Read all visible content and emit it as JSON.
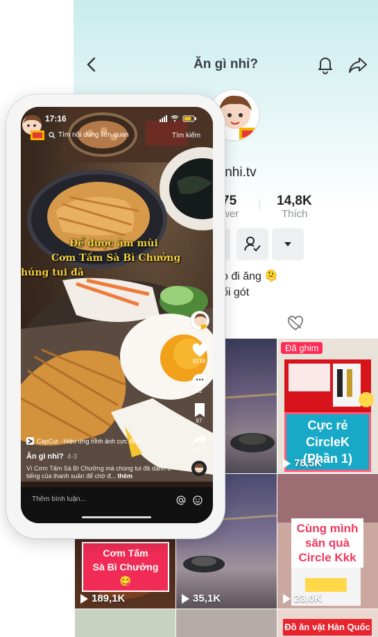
{
  "profile": {
    "title": "Ăn gì nhỉ?",
    "username_partial": "inhi.tv",
    "stats": [
      {
        "value": "75",
        "label": "wer"
      },
      {
        "value": "14,8K",
        "label": "Thích"
      }
    ],
    "bio_line1": "o đi ăng 🫠",
    "bio_line2": "ối gót",
    "grid": [
      {
        "views": "",
        "pinned": ""
      },
      {
        "views": "78,5K",
        "pinned": "Đã ghim",
        "caption": "Cực rẻ CircleK\n(Phần 1)"
      },
      {
        "views": "189,1K",
        "caption": "Cơm Tấm\nSà Bì Chưởng 😋"
      },
      {
        "views": "35,1K"
      },
      {
        "views": "23,0K",
        "caption": "Cùng mình\nsăn quà\nCircle Kkk"
      },
      {
        "caption": "Đồ ăn vặt Hàn Quốc"
      }
    ]
  },
  "phone": {
    "time": "17:16",
    "search_placeholder": "Tìm nội dung liên quan",
    "search_button": "Tìm kiếm",
    "overlay_line1": "Để được ăm mùi",
    "overlay_line2": "Cơm Tấm Sà Bì Chưởng",
    "overlay_line3": "húng tui đã",
    "likes": "8218",
    "comments": "82",
    "saves": "87",
    "shares": "154",
    "capcut": "CapCut · Hiệu ứng hình ảnh cực đỉnh",
    "author": "Ăn gì nhỉ?",
    "date": "4-3",
    "description": "Vì Cơm Tấm Sà Bì Chưởng mà chúng tui đã dành 3 tiếng của thanh xuân để chờ đ...",
    "more": "thêm",
    "comment_placeholder": "Thêm bình luận..."
  },
  "colors": {
    "accent": "#fe2c55",
    "teal": "#c9ecec"
  }
}
